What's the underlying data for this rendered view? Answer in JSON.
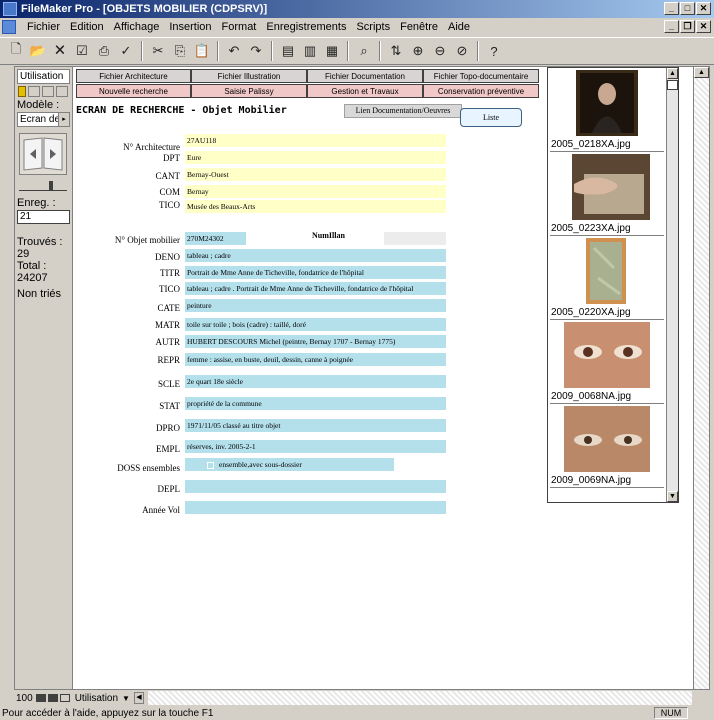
{
  "window": {
    "title": "FileMaker Pro - [OBJETS MOBILIER (CDPSRV)]"
  },
  "menu": [
    "Fichier",
    "Edition",
    "Affichage",
    "Insertion",
    "Format",
    "Enregistrements",
    "Scripts",
    "Fenêtre",
    "Aide"
  ],
  "left": {
    "mode_label": "Utilisation",
    "model_label": "Modèle :",
    "model_value": "Ecran de",
    "record_label": "Enreg. :",
    "record_value": "21",
    "found_label": "Trouvés :",
    "found_value": "29",
    "total_label": "Total :",
    "total_value": "24207",
    "sort_label": "Non triés"
  },
  "tabs_row1": [
    "Fichier Architecture",
    "Fichier Illustration",
    "Fichier Documentation",
    "Fichier Topo-documentaire"
  ],
  "tabs_row2": [
    "Nouvelle recherche",
    "Saisie Palissy",
    "Gestion et Travaux",
    "Conservation préventive"
  ],
  "form": {
    "title": "ECRAN DE RECHERCHE - Objet Mobilier",
    "lien_button": "Lien Documentation/Oeuvres",
    "liste_button": "Liste",
    "numillan_label": "NumIllan",
    "fields": {
      "arch_label": "N° Architecture",
      "arch_value": "27AU118",
      "dpt_label": "DPT",
      "dpt_value": "Eure",
      "cant_label": "CANT",
      "cant_value": "Bernay-Ouest",
      "com_label": "COM",
      "com_value": "Bernay",
      "tico1_label": "TICO",
      "tico1_value": "Musée des Beaux-Arts",
      "obj_label": "N° Objet mobilier",
      "obj_value": "270M24302",
      "deno_label": "DENO",
      "deno_value": "tableau ; cadre",
      "titr_label": "TITR",
      "titr_value": "Portrait de Mme Anne de Ticheville, fondatrice de l'hôpital",
      "tico2_label": "TICO",
      "tico2_value": "tableau ; cadre . Portrait de Mme Anne de Ticheville, fondatrice de l'hôpital",
      "cate_label": "CATE",
      "cate_value": "peinture",
      "matr_label": "MATR",
      "matr_value": "toile sur toile ; bois (cadre) : taillé, doré",
      "autr_label": "AUTR",
      "autr_value": "HUBERT DESCOURS Michel (peintre, Bernay 1707 - Bernay 1775)",
      "repr_label": "REPR",
      "repr_value": "femme : assise, en buste, deuil, dessin, canne à poignée",
      "scle_label": "SCLE",
      "scle_value": "2e quart 18e siècle",
      "stat_label": "STAT",
      "stat_value": "propriété de la commune",
      "dpro_label": "DPRO",
      "dpro_value": "1971/11/05 classé au titre objet",
      "empl_label": "EMPL",
      "empl_value": "réserves, inv. 2005-2-1",
      "doss_label": "DOSS ensembles",
      "doss_value": "ensemble,avec sous-dossier",
      "depl_label": "DEPL",
      "depl_value": "",
      "annee_label": "Année Vol",
      "annee_value": ""
    }
  },
  "portal": {
    "captions": [
      "2005_0218XA.jpg",
      "2005_0223XA.jpg",
      "2005_0220XA.jpg",
      "2009_0068NA.jpg",
      "2009_0069NA.jpg"
    ]
  },
  "bottom": {
    "zoom": "100",
    "mode": "Utilisation"
  },
  "status": {
    "text": "Pour accéder à l'aide, appuyez sur la touche F1",
    "num": "NUM"
  }
}
